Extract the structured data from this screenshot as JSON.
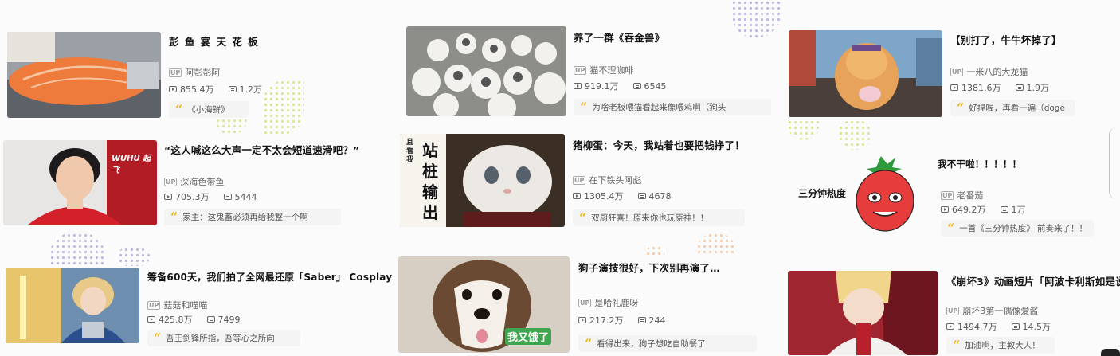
{
  "colors": {
    "accent_quote": "#f2b81f",
    "card_bg": "#fbfbfb",
    "comment_bg": "#f4f4f4"
  },
  "icons": {
    "views": "play-icon",
    "danmaku": "danmaku-icon",
    "uploader": "up-badge-icon",
    "comment": "quote-icon"
  },
  "up_badge": "UP",
  "videos": [
    {
      "title": "彭 鱼 宴 天 花 板",
      "uploader": "阿彭彭阿",
      "views": "855.4万",
      "danmaku": "1.2万",
      "comment": "《小海鲜》"
    },
    {
      "title": "“这人喊这么大声一定不太会短道速滑吧？”",
      "uploader": "深海色带鱼",
      "views": "705.3万",
      "danmaku": "5444",
      "comment": "家主：这鬼畜必须再给我整一个啊",
      "thumb_text": "WUHU 起飞"
    },
    {
      "title": "筹备600天，我们拍了全网最还原「Saber」 Cosplay",
      "uploader": "菇菇和喵喵",
      "views": "425.8万",
      "danmaku": "7499",
      "comment": "吾王剑锋所指，吾等心之所向"
    },
    {
      "title": "养了一群《吞金兽》",
      "uploader": "猫不理咖啡",
      "views": "919.1万",
      "danmaku": "6545",
      "comment": "为啥老板喂猫看起来像喂鸡啊（狗头"
    },
    {
      "title": "猪柳蛋：今天，我站着也要把钱挣了！",
      "uploader": "在下铁头阿彪",
      "views": "1305.4万",
      "danmaku": "4678",
      "comment": "双厨狂喜！原来你也玩原神！！",
      "thumb_text_small": "且看我",
      "thumb_text_big": "站桩输出"
    },
    {
      "title": "狗子演技很好，下次别再演了…",
      "uploader": "是哈礼鹿呀",
      "views": "217.2万",
      "danmaku": "244",
      "comment": "看得出来，狗子想吃自助餐了",
      "thumb_text": "我又饿了"
    },
    {
      "title": "【别打了，牛牛坏掉了】",
      "uploader": "一米八的大龙猫",
      "views": "1381.6万",
      "danmaku": "1.9万",
      "comment": "好捏喔，再看一遍（doge"
    },
    {
      "title": "我不干啦！！！！！",
      "uploader": "老番茄",
      "views": "649.2万",
      "danmaku": "1万",
      "comment": "一首《三分钟热度》 前奏来了！！",
      "thumb_text": "三分钟热度"
    },
    {
      "title": "《崩坏3》动画短片「阿波卡利斯如是说",
      "uploader": "崩坏3第一偶像爱酱",
      "views": "1494.7万",
      "danmaku": "14.5万",
      "comment": "加油啊，主教大人！"
    }
  ]
}
